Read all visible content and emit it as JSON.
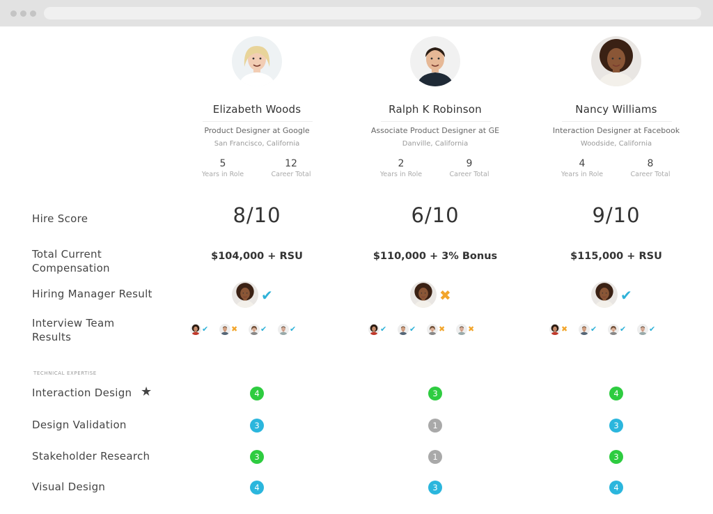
{
  "colors": {
    "green": "#2ecc40",
    "blue": "#2bb6dd",
    "gray": "#a9a9a9",
    "check": "#2fb2d8",
    "cross": "#f2a52b"
  },
  "rows": {
    "hire_score": "Hire Score",
    "total_comp": "Total Current Compensation",
    "hiring_manager": "Hiring Manager Result",
    "interview_team": "Interview Team Results",
    "section": "TECHNICAL EXPERTISE",
    "skills": [
      "Interaction Design",
      "Design Validation",
      "Stakeholder Research",
      "Visual Design"
    ]
  },
  "icons": {
    "star": "star-icon",
    "check": "check-icon",
    "cross": "cross-icon"
  },
  "candidates": [
    {
      "name": "Elizabeth Woods",
      "title": "Product Designer at Google",
      "location": "San Francisco, California",
      "years_in_role": "5",
      "years_label": "Years in Role",
      "career_total": "12",
      "career_label": "Career Total",
      "hire_score": "8/10",
      "compensation": "$104,000 + RSU",
      "manager_result": "check",
      "team": [
        "check",
        "cross",
        "check",
        "check"
      ],
      "skills": [
        4,
        3,
        3,
        4
      ],
      "skill_colors": [
        "green",
        "blue",
        "green",
        "blue"
      ]
    },
    {
      "name": "Ralph K Robinson",
      "title": "Associate Product Designer at GE",
      "location": "Danville, California",
      "years_in_role": "2",
      "years_label": "Years in Role",
      "career_total": "9",
      "career_label": "Career Total",
      "hire_score": "6/10",
      "compensation": "$110,000 + 3% Bonus",
      "manager_result": "cross",
      "team": [
        "check",
        "check",
        "cross",
        "cross"
      ],
      "skills": [
        3,
        1,
        1,
        3
      ],
      "skill_colors": [
        "green",
        "gray",
        "gray",
        "blue"
      ]
    },
    {
      "name": "Nancy Williams",
      "title": "Interaction Designer at Facebook",
      "location": "Woodside, California",
      "years_in_role": "4",
      "years_label": "Years in Role",
      "career_total": "8",
      "career_label": "Career Total",
      "hire_score": "9/10",
      "compensation": "$115,000 + RSU",
      "manager_result": "check",
      "team": [
        "cross",
        "check",
        "check",
        "check"
      ],
      "skills": [
        4,
        3,
        3,
        4
      ],
      "skill_colors": [
        "green",
        "blue",
        "green",
        "blue"
      ]
    }
  ]
}
